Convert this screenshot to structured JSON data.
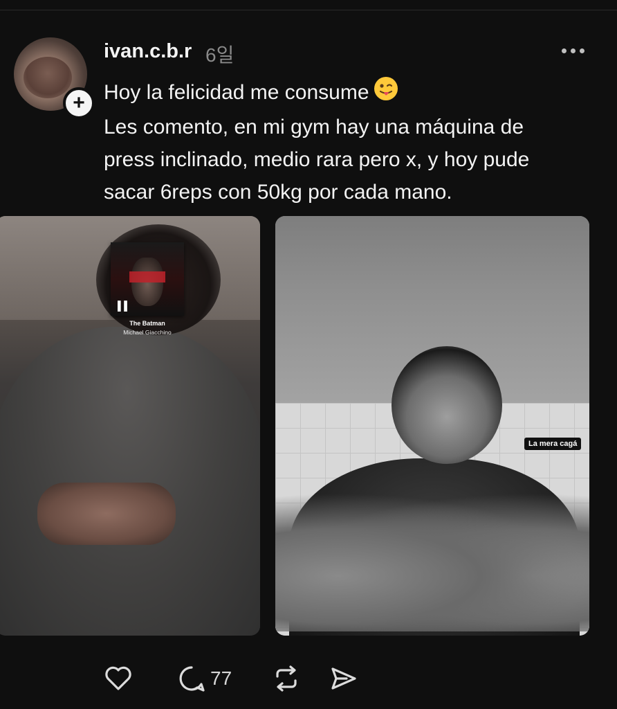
{
  "post": {
    "username": "ivan.c.b.r",
    "time": "6일",
    "lines": [
      "Hoy la felicidad me consume",
      "Les comento, en mi gym hay una máquina de",
      "press inclinado, medio rara pero x, y hoy pude",
      "sacar 6reps con 50kg por cada mano."
    ],
    "emoji": "tongue-out-emoji"
  },
  "photos": {
    "left": {
      "music_sticker": {
        "title": "The Batman",
        "artist": "Michael Giacchino",
        "icon": "music-bars-icon"
      }
    },
    "right": {
      "sticker_text": "La mera cagá"
    }
  },
  "actions": {
    "like_icon": "heart-icon",
    "comment_icon": "comment-icon",
    "comment_count": "77",
    "repost_icon": "repost-icon",
    "share_icon": "send-icon"
  },
  "colors": {
    "background": "#0f0f0f",
    "text": "#f3f3f3",
    "muted": "#8a8a8a"
  }
}
